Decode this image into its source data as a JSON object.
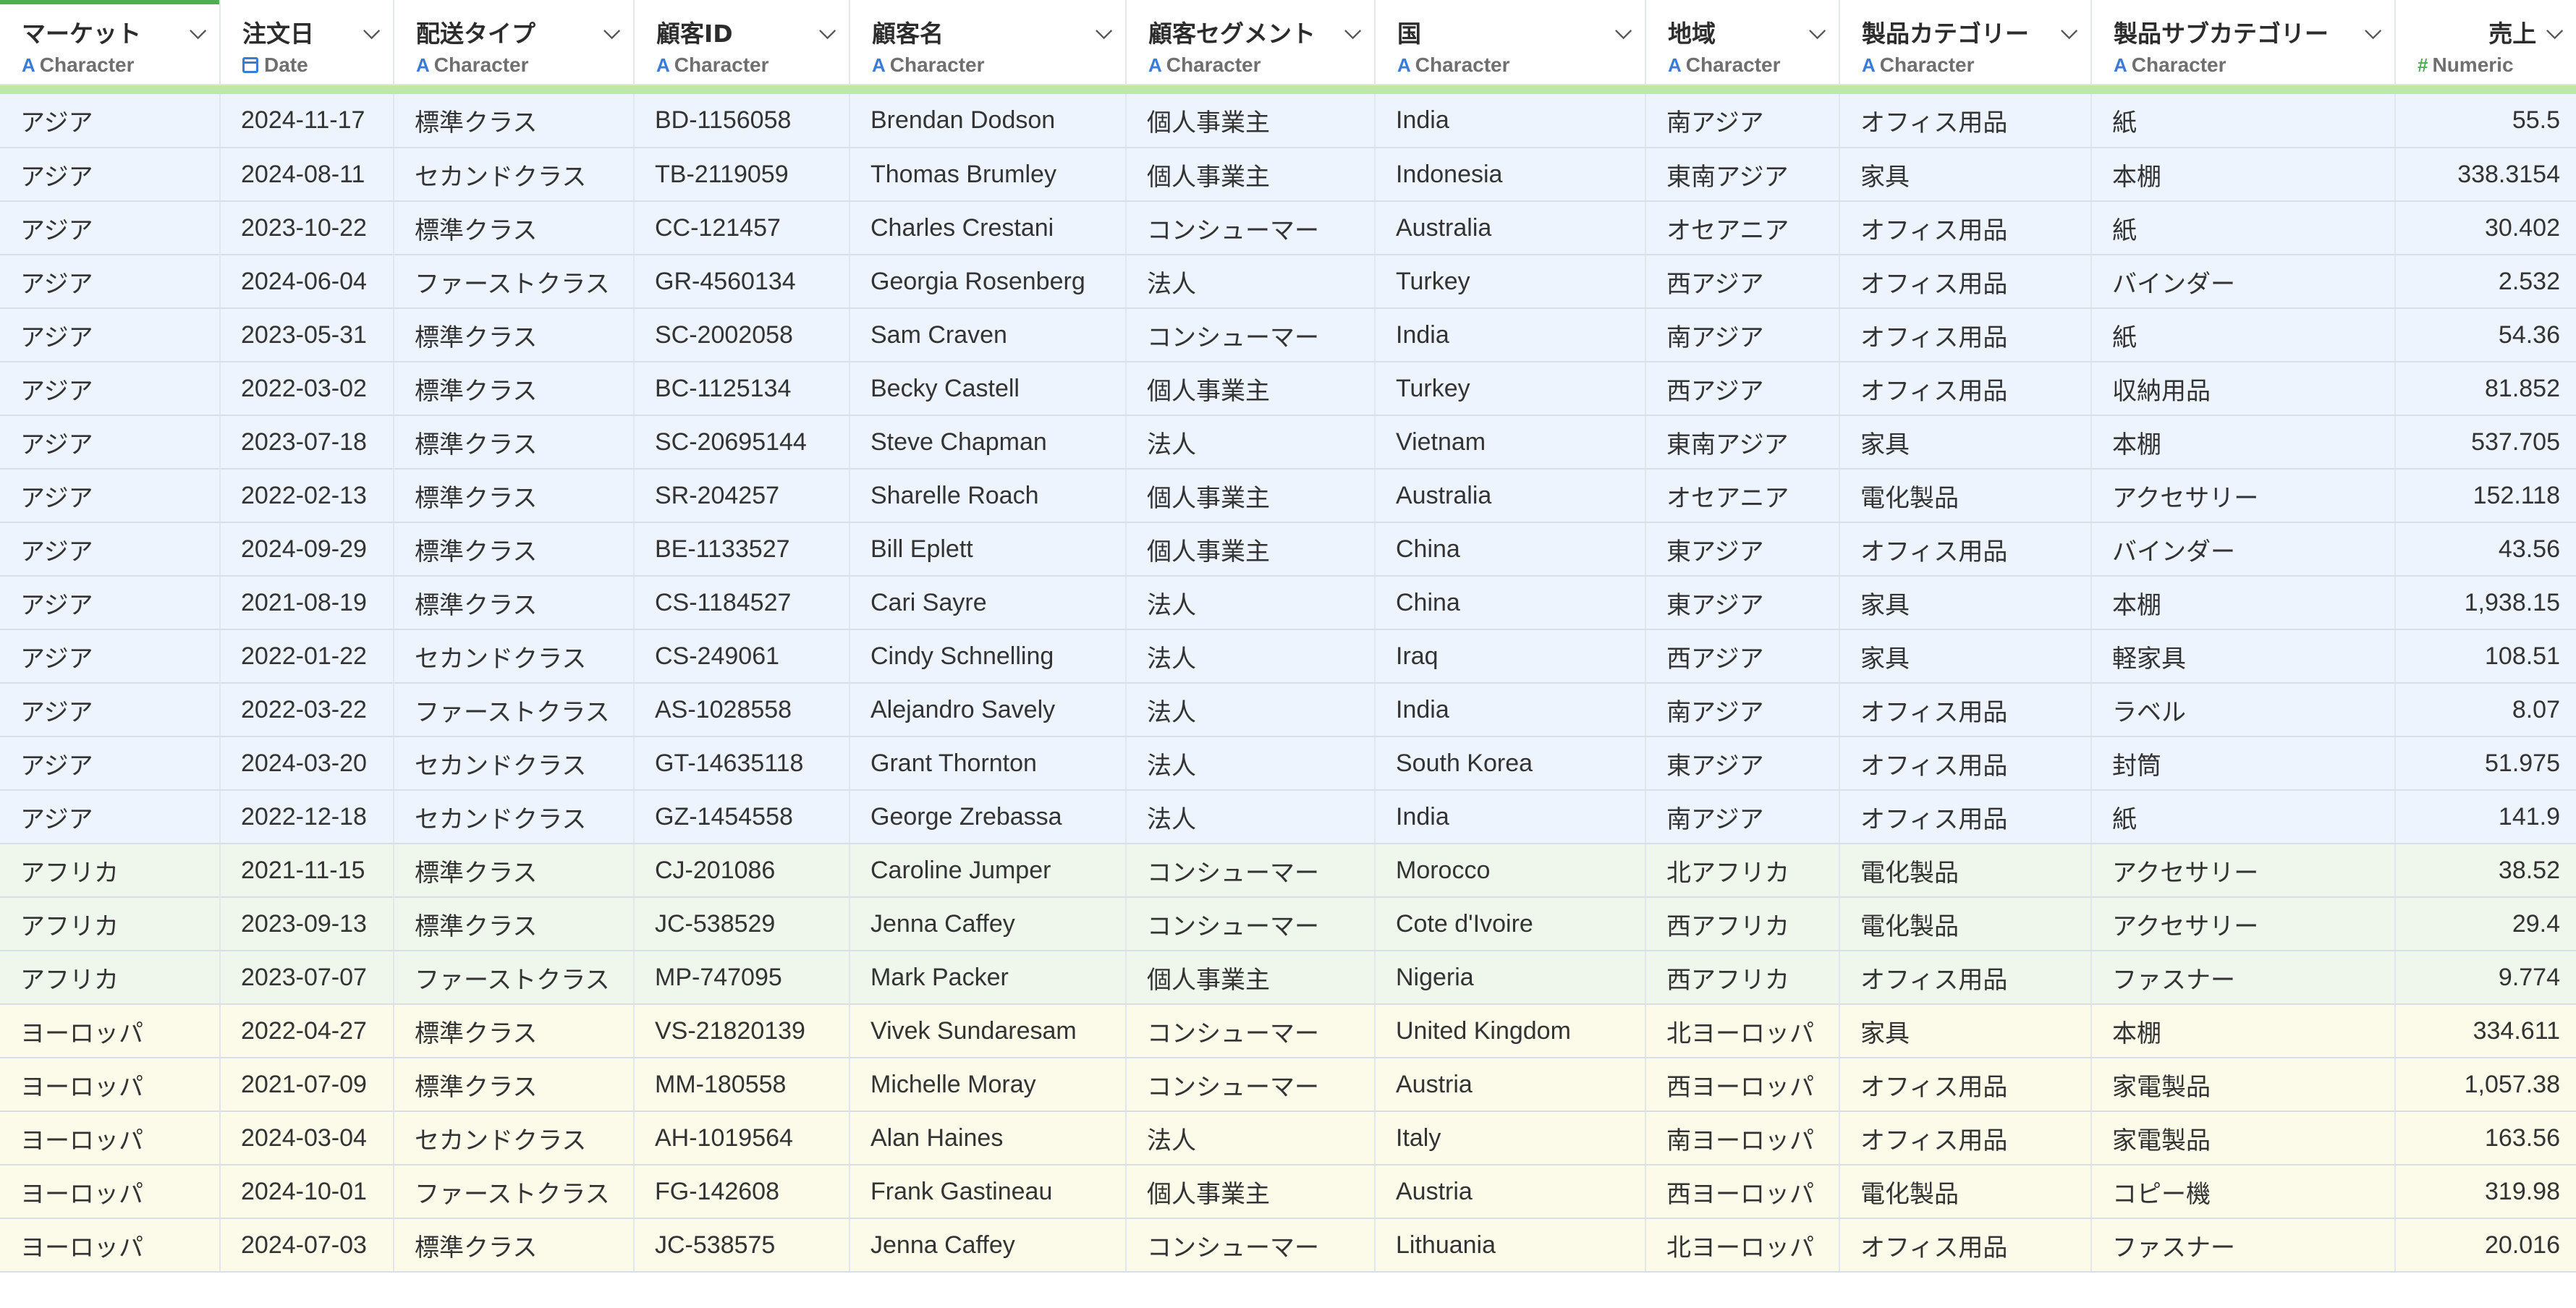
{
  "columns": [
    {
      "name": "マーケット",
      "type": "Character",
      "icon": "character-type-icon"
    },
    {
      "name": "注文日",
      "type": "Date",
      "icon": "calendar-icon"
    },
    {
      "name": "配送タイプ",
      "type": "Character",
      "icon": "character-type-icon"
    },
    {
      "name": "顧客ID",
      "type": "Character",
      "icon": "character-type-icon"
    },
    {
      "name": "顧客名",
      "type": "Character",
      "icon": "character-type-icon"
    },
    {
      "name": "顧客セグメント",
      "type": "Character",
      "icon": "character-type-icon"
    },
    {
      "name": "国",
      "type": "Character",
      "icon": "character-type-icon"
    },
    {
      "name": "地域",
      "type": "Character",
      "icon": "character-type-icon"
    },
    {
      "name": "製品カテゴリー",
      "type": "Character",
      "icon": "character-type-icon"
    },
    {
      "name": "製品サブカテゴリー",
      "type": "Character",
      "icon": "character-type-icon"
    },
    {
      "name": "売上",
      "type": "Numeric",
      "icon": "numeric-hash-icon"
    }
  ],
  "type_glyphs": {
    "Character": "A",
    "Numeric": "#"
  },
  "colors": {
    "asia": "#eef4fd",
    "africa": "#eff6ec",
    "europe": "#fcfbea",
    "accent": "#4caf50",
    "band": "#bde8a8"
  },
  "rows": [
    {
      "group": "asia",
      "cells": [
        "アジア",
        "2024-11-17",
        "標準クラス",
        "BD-1156058",
        "Brendan Dodson",
        "個人事業主",
        "India",
        "南アジア",
        "オフィス用品",
        "紙",
        "55.5"
      ]
    },
    {
      "group": "asia",
      "cells": [
        "アジア",
        "2024-08-11",
        "セカンドクラス",
        "TB-2119059",
        "Thomas Brumley",
        "個人事業主",
        "Indonesia",
        "東南アジア",
        "家具",
        "本棚",
        "338.3154"
      ]
    },
    {
      "group": "asia",
      "cells": [
        "アジア",
        "2023-10-22",
        "標準クラス",
        "CC-121457",
        "Charles Crestani",
        "コンシューマー",
        "Australia",
        "オセアニア",
        "オフィス用品",
        "紙",
        "30.402"
      ]
    },
    {
      "group": "asia",
      "cells": [
        "アジア",
        "2024-06-04",
        "ファーストクラス",
        "GR-4560134",
        "Georgia Rosenberg",
        "法人",
        "Turkey",
        "西アジア",
        "オフィス用品",
        "バインダー",
        "2.532"
      ]
    },
    {
      "group": "asia",
      "cells": [
        "アジア",
        "2023-05-31",
        "標準クラス",
        "SC-2002058",
        "Sam Craven",
        "コンシューマー",
        "India",
        "南アジア",
        "オフィス用品",
        "紙",
        "54.36"
      ]
    },
    {
      "group": "asia",
      "cells": [
        "アジア",
        "2022-03-02",
        "標準クラス",
        "BC-1125134",
        "Becky Castell",
        "個人事業主",
        "Turkey",
        "西アジア",
        "オフィス用品",
        "収納用品",
        "81.852"
      ]
    },
    {
      "group": "asia",
      "cells": [
        "アジア",
        "2023-07-18",
        "標準クラス",
        "SC-20695144",
        "Steve Chapman",
        "法人",
        "Vietnam",
        "東南アジア",
        "家具",
        "本棚",
        "537.705"
      ]
    },
    {
      "group": "asia",
      "cells": [
        "アジア",
        "2022-02-13",
        "標準クラス",
        "SR-204257",
        "Sharelle Roach",
        "個人事業主",
        "Australia",
        "オセアニア",
        "電化製品",
        "アクセサリー",
        "152.118"
      ]
    },
    {
      "group": "asia",
      "cells": [
        "アジア",
        "2024-09-29",
        "標準クラス",
        "BE-1133527",
        "Bill Eplett",
        "個人事業主",
        "China",
        "東アジア",
        "オフィス用品",
        "バインダー",
        "43.56"
      ]
    },
    {
      "group": "asia",
      "cells": [
        "アジア",
        "2021-08-19",
        "標準クラス",
        "CS-1184527",
        "Cari Sayre",
        "法人",
        "China",
        "東アジア",
        "家具",
        "本棚",
        "1,938.15"
      ]
    },
    {
      "group": "asia",
      "cells": [
        "アジア",
        "2022-01-22",
        "セカンドクラス",
        "CS-249061",
        "Cindy Schnelling",
        "法人",
        "Iraq",
        "西アジア",
        "家具",
        "軽家具",
        "108.51"
      ]
    },
    {
      "group": "asia",
      "cells": [
        "アジア",
        "2022-03-22",
        "ファーストクラス",
        "AS-1028558",
        "Alejandro Savely",
        "法人",
        "India",
        "南アジア",
        "オフィス用品",
        "ラベル",
        "8.07"
      ]
    },
    {
      "group": "asia",
      "cells": [
        "アジア",
        "2024-03-20",
        "セカンドクラス",
        "GT-14635118",
        "Grant Thornton",
        "法人",
        "South Korea",
        "東アジア",
        "オフィス用品",
        "封筒",
        "51.975"
      ]
    },
    {
      "group": "asia",
      "cells": [
        "アジア",
        "2022-12-18",
        "セカンドクラス",
        "GZ-1454558",
        "George Zrebassa",
        "法人",
        "India",
        "南アジア",
        "オフィス用品",
        "紙",
        "141.9"
      ]
    },
    {
      "group": "africa",
      "cells": [
        "アフリカ",
        "2021-11-15",
        "標準クラス",
        "CJ-201086",
        "Caroline Jumper",
        "コンシューマー",
        "Morocco",
        "北アフリカ",
        "電化製品",
        "アクセサリー",
        "38.52"
      ]
    },
    {
      "group": "africa",
      "cells": [
        "アフリカ",
        "2023-09-13",
        "標準クラス",
        "JC-538529",
        "Jenna Caffey",
        "コンシューマー",
        "Cote d'Ivoire",
        "西アフリカ",
        "電化製品",
        "アクセサリー",
        "29.4"
      ]
    },
    {
      "group": "africa",
      "cells": [
        "アフリカ",
        "2023-07-07",
        "ファーストクラス",
        "MP-747095",
        "Mark Packer",
        "個人事業主",
        "Nigeria",
        "西アフリカ",
        "オフィス用品",
        "ファスナー",
        "9.774"
      ]
    },
    {
      "group": "europe",
      "cells": [
        "ヨーロッパ",
        "2022-04-27",
        "標準クラス",
        "VS-21820139",
        "Vivek Sundaresam",
        "コンシューマー",
        "United Kingdom",
        "北ヨーロッパ",
        "家具",
        "本棚",
        "334.611"
      ]
    },
    {
      "group": "europe",
      "cells": [
        "ヨーロッパ",
        "2021-07-09",
        "標準クラス",
        "MM-180558",
        "Michelle Moray",
        "コンシューマー",
        "Austria",
        "西ヨーロッパ",
        "オフィス用品",
        "家電製品",
        "1,057.38"
      ]
    },
    {
      "group": "europe",
      "cells": [
        "ヨーロッパ",
        "2024-03-04",
        "セカンドクラス",
        "AH-1019564",
        "Alan Haines",
        "法人",
        "Italy",
        "南ヨーロッパ",
        "オフィス用品",
        "家電製品",
        "163.56"
      ]
    },
    {
      "group": "europe",
      "cells": [
        "ヨーロッパ",
        "2024-10-01",
        "ファーストクラス",
        "FG-142608",
        "Frank Gastineau",
        "個人事業主",
        "Austria",
        "西ヨーロッパ",
        "電化製品",
        "コピー機",
        "319.98"
      ]
    },
    {
      "group": "europe",
      "cells": [
        "ヨーロッパ",
        "2024-07-03",
        "標準クラス",
        "JC-538575",
        "Jenna Caffey",
        "コンシューマー",
        "Lithuania",
        "北ヨーロッパ",
        "オフィス用品",
        "ファスナー",
        "20.016"
      ]
    }
  ]
}
